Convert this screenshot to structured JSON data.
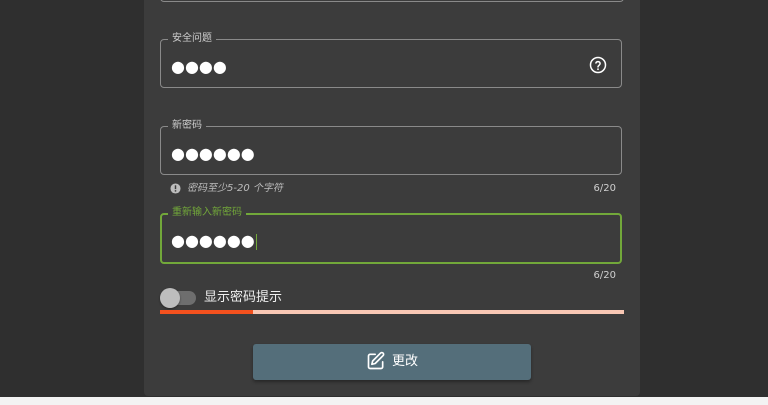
{
  "form": {
    "security_question": {
      "label": "安全问题",
      "value": "●●●●",
      "help_icon": "help-circle-icon"
    },
    "new_password": {
      "label": "新密码",
      "value": "●●●●●●",
      "hint": "密码至少5-20 个字符",
      "hint_icon": "info-icon",
      "counter": "6/20"
    },
    "confirm_password": {
      "label": "重新输入新密码",
      "value": "●●●●●●",
      "counter": "6/20"
    },
    "show_hint_toggle": {
      "label": "显示密码提示",
      "on": false
    },
    "password_strength": {
      "fraction": 0.2,
      "fill_color": "#f4511e",
      "track_color": "#f8c7b4"
    },
    "submit": {
      "label": "更改",
      "icon": "edit-icon"
    }
  },
  "colors": {
    "panel": "#3c3c3c",
    "focus": "#72a83a",
    "button": "#546e7a"
  }
}
